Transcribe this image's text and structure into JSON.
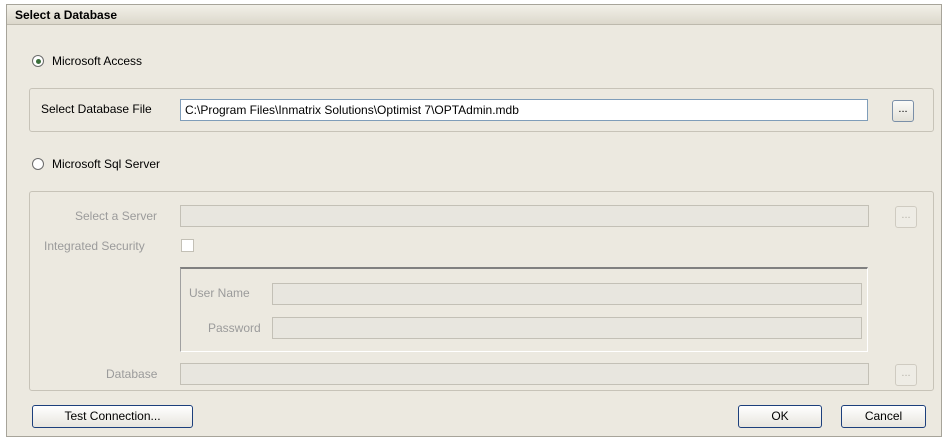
{
  "title": "Select a Database",
  "access": {
    "option_label": "Microsoft Access",
    "selected": true,
    "file_label": "Select Database File",
    "file_value": "C:\\Program Files\\Inmatrix Solutions\\Optimist 7\\OPTAdmin.mdb",
    "browse_label": "..."
  },
  "sql": {
    "option_label": "Microsoft Sql Server",
    "selected": false,
    "server_label": "Select a Server",
    "server_value": "",
    "server_browse_label": "...",
    "integrated_label": "Integrated Security",
    "username_label": "User Name",
    "username_value": "",
    "password_label": "Password",
    "password_value": "",
    "database_label": "Database",
    "database_value": "",
    "database_browse_label": "..."
  },
  "buttons": {
    "test_connection": "Test Connection...",
    "ok": "OK",
    "cancel": "Cancel"
  }
}
